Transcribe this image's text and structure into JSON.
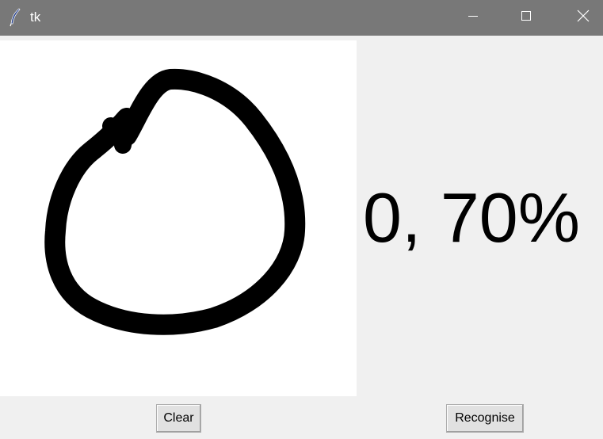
{
  "window": {
    "title": "tk"
  },
  "result": {
    "text": "0, 70%"
  },
  "buttons": {
    "clear_label": "Clear",
    "recognise_label": "Recognise"
  },
  "colors": {
    "titlebar": "#787878",
    "background": "#f0f0f0",
    "canvas": "#ffffff",
    "stroke": "#000000"
  },
  "icons": {
    "app": "feather-icon",
    "minimize": "minimize-icon",
    "maximize": "maximize-icon",
    "close": "close-icon"
  }
}
